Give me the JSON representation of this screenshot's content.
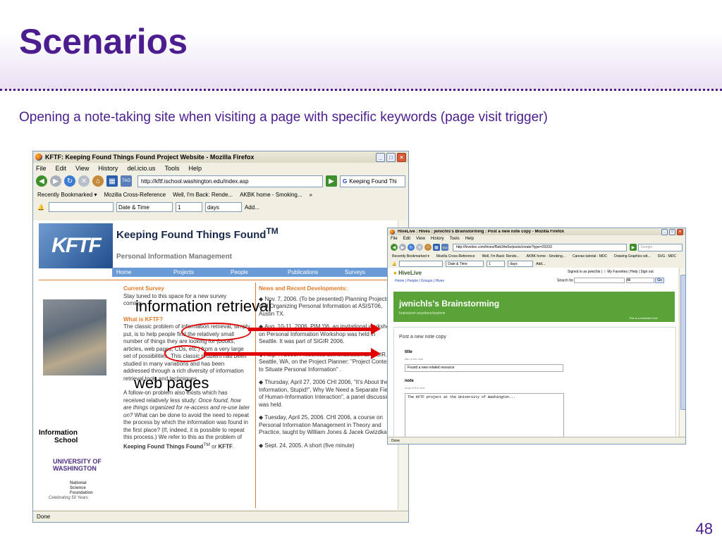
{
  "slide": {
    "title": "Scenarios",
    "subtitle": "Opening a note-taking site when visiting a page with specific keywords (page visit trigger)",
    "page_number": "48"
  },
  "annotations": {
    "label1": "information retrieval",
    "label2": "web pages"
  },
  "colors": {
    "accent": "#4b1d8f",
    "annotation": "#e00000"
  },
  "window1": {
    "title": "KFTF: Keeping Found Things Found Project Website - Mozilla Firefox",
    "menu": [
      "File",
      "Edit",
      "View",
      "History",
      "del.icio.us",
      "Tools",
      "Help"
    ],
    "url": "http://kftf.ischool.washington.edu/index.asp",
    "search": "Keeping Found Thi",
    "bookmarks": [
      "Recently Bookmarked ▾",
      "Mozilla Cross-Reference",
      "Well, I'm Back: Rende...",
      "AKBK home - Smoking...",
      "»"
    ],
    "reminder": {
      "type": "Date & Time",
      "count": "1",
      "unit": "days",
      "add": "Add..."
    },
    "status": "Done",
    "page": {
      "logo": "KFTF",
      "heading": "Keeping Found Things Found",
      "tm": "TM",
      "subheading": "Personal Information Management",
      "nav": [
        "Home",
        "Projects",
        "People",
        "Publications",
        "Surveys"
      ],
      "left_col": {
        "current_survey": "Current Survey",
        "survey_text": "Stay tuned to this space for a new survey coming...",
        "what_is": "What is KFTF?",
        "p1": "The classic problem of information retrieval, simply put, is to help people find the relatively small number of things they are looking for (books, articles, web pages, CDs, etc.) from a very large set of possibilities. This classic problem has been studied in many variations and has been addressed through a rich diversity of information retrieval tools and techniques.",
        "p2a": "A follow-on problem also exists which has received relatively less study: ",
        "p2b": "Once found, how are things organized for re-access and re-use later on?",
        "p2c": " What can be done to avoid the need to repeat the process by which the information was found in the first place? (If, indeed, it is possible to repeat this process.) We refer to this as the problem of ",
        "p2d": "Keeping Found Things Found",
        "p2e": "TM",
        "p2f": " or ",
        "p2g": "KFTF",
        "p2h": "."
      },
      "right_col": {
        "news": "News and Recent Developments:",
        "n1": "Nov. 7, 2006. (To be presented) Planning Projects and Organizing Personal Information at ASIST06, Austin TX.",
        "n2": "Aug. 10-11, 2006. PIM '06, an invitational workshop on Personal Information Workshop was held in Seattle. It was part of SIGIR 2006.",
        "n3": "Aug. 7. 2006. Presented demonstration at SIGIR. Seattle, WA, on the Project Planner: \"Project Contexts to Situate Personal Information\" .",
        "n4": "Thursday, April 27, 2006 CHI 2006, \"It's About the Information, Stupid!\", Why We Need a Separate Field of Human-Information Interaction\", a panel discussion was held.",
        "n5": "Tuesday, April 25, 2006. CHI 2006, a course on Personal Information Management in Theory and Practice, taught by William Jones & Jacek Gwizdka.",
        "n6": "Sept. 24, 2005. A short (five minute)"
      },
      "logos": {
        "ischool1": "Information",
        "ischool2": "School",
        "uw1": "UNIVERSITY OF",
        "uw2": "WASHINGTON",
        "nsf1": "National",
        "nsf2": "Science",
        "nsf3": "Foundation",
        "nsf4": "Celebrating 50 Years"
      }
    }
  },
  "window2": {
    "title": "HiveLive : Hives : jwnichls's Brainstorming : Post a new note copy - Mozilla Firefox",
    "menu": [
      "File",
      "Edit",
      "View",
      "History",
      "Tools",
      "Help"
    ],
    "url": "http://hivelive.com/hives/f5eb34e5e/posts/create?type=20233",
    "search": "Google",
    "bookmarks": [
      "Recently Bookmarked ▾",
      "Mozilla Cross-Reference",
      "Well, I'm Back: Rende...",
      "AKBK home - Smoking...",
      "Canvas tutorial - MDC",
      "Drawing Graphics wit...",
      "SVG - MDC"
    ],
    "reminder": {
      "type": "Date & Time",
      "count": "1",
      "unit": "days",
      "add": "Add..."
    },
    "status": "Done",
    "page": {
      "logo": "HiveLive",
      "links": "Home | People | Groups | Hives",
      "signed_in": "Signed in as jwnichls | ☆ My Favorites | Help | Sign out",
      "search_label": "Search for",
      "search_scope": "All",
      "search_btn": "Go",
      "banner_title": "jwnichls's Brainstorming",
      "banner_sub": "brainstorm anywhere/anytime",
      "banner_private": "This is a restricted hive",
      "form_head": "Post a new note copy",
      "title_label": "title",
      "title_hint": "title of the note",
      "title_value": "Found a new related resource",
      "note_label": "note",
      "note_hint": "body of the note",
      "note_value": "The KFTF project at the University of Washington..."
    }
  }
}
